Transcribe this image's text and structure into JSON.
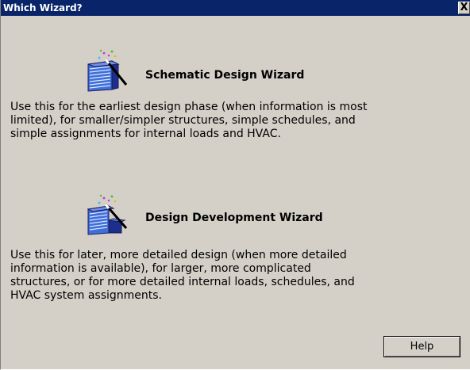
{
  "window": {
    "title": "Which Wizard?",
    "close_label": "X"
  },
  "schematic": {
    "title": "Schematic Design Wizard",
    "description_lines": [
      "Use this for the earliest design phase (when information is most",
      "limited), for smaller/simpler structures, simple schedules, and",
      "simple assignments for internal loads and HVAC."
    ],
    "icon": "building-wand-icon"
  },
  "development": {
    "title": "Design Development Wizard",
    "description_lines": [
      "Use this for later, more detailed design (when more detailed",
      "information is available), for larger, more complicated",
      "structures, or for more detailed internal loads, schedules, and",
      "HVAC system assignments."
    ],
    "icon": "building-wand-icon"
  },
  "help_button": {
    "label": "Help"
  },
  "colors": {
    "titlebar": "#0a246a",
    "dialog_background": "#d4d0c8",
    "building_blue": "#3f6fd8"
  }
}
